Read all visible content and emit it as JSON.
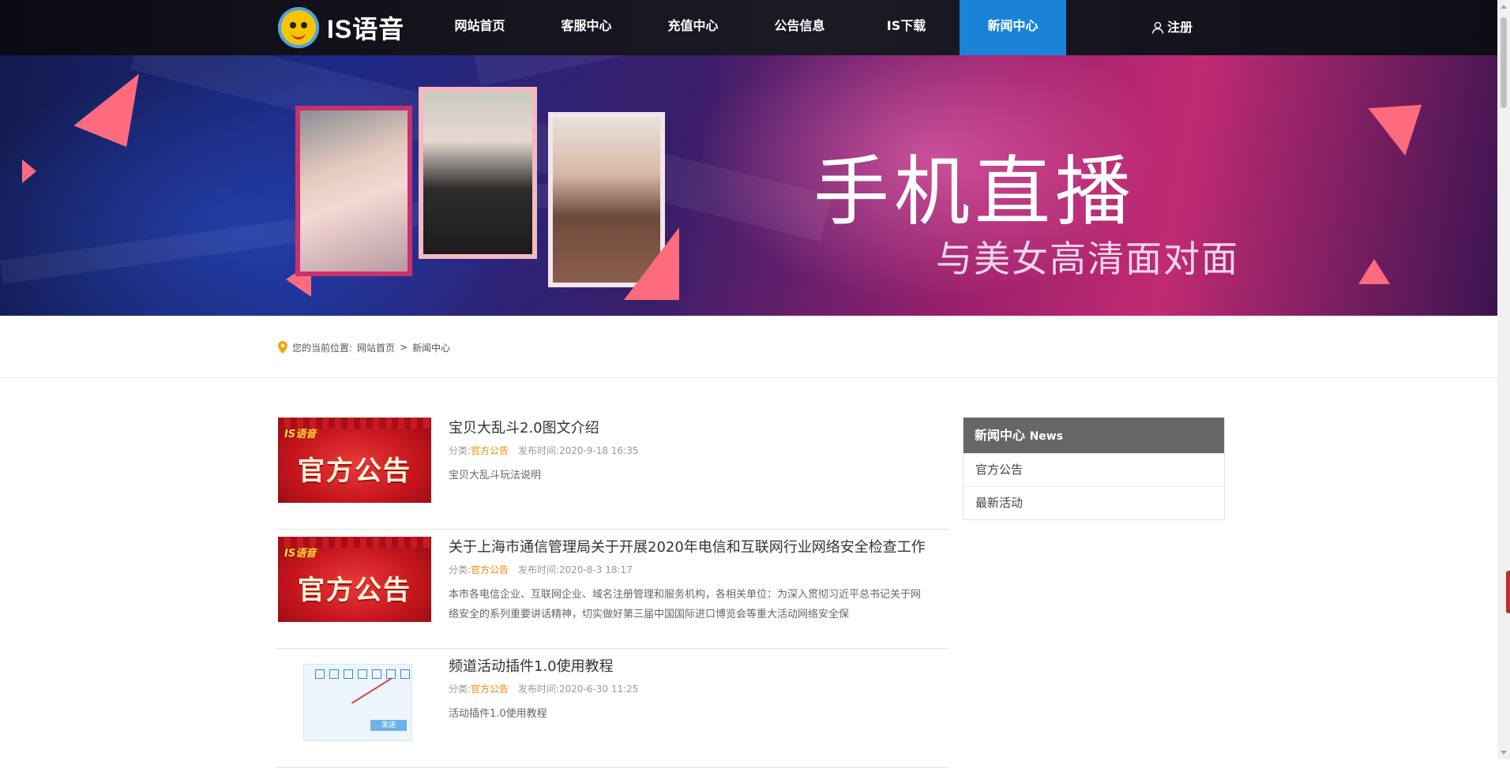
{
  "header": {
    "logo_text": "IS语音",
    "nav": [
      {
        "label": "网站首页",
        "active": false
      },
      {
        "label": "客服中心",
        "active": false
      },
      {
        "label": "充值中心",
        "active": false
      },
      {
        "label": "公告信息",
        "active": false
      },
      {
        "label": "IS下载",
        "active": false
      },
      {
        "label": "新闻中心",
        "active": true
      }
    ],
    "register_label": "注册",
    "colors": {
      "active_tab": "#1a83d8"
    }
  },
  "banner": {
    "title": "手机直播",
    "subtitle": "与美女高清面对面"
  },
  "breadcrumb": {
    "prefix": "您的当前位置:",
    "items": [
      "网站首页",
      "新闻中心"
    ],
    "separator": ">"
  },
  "news": [
    {
      "title": "宝贝大乱斗2.0图文介绍",
      "category_label": "分类:",
      "category": "官方公告",
      "time_label": "发布时间:",
      "time": "2020-9-18 16:35",
      "desc": "宝贝大乱斗玩法说明",
      "thumb_text": "官方公告",
      "thumb_brand": "IS语音"
    },
    {
      "title": "关于上海市通信管理局关于开展2020年电信和互联网行业网络安全检查工作",
      "category_label": "分类:",
      "category": "官方公告",
      "time_label": "发布时间:",
      "time": "2020-8-3 18:17",
      "desc": "本市各电信企业、互联网企业、域名注册管理和服务机构，各相关单位：为深入贯彻习近平总书记关于网络安全的系列重要讲话精神，切实做好第三届中国国际进口博览会等重大活动网络安全保",
      "thumb_text": "官方公告",
      "thumb_brand": "IS语音"
    },
    {
      "title": "频道活动插件1.0使用教程",
      "category_label": "分类:",
      "category": "官方公告",
      "time_label": "发布时间:",
      "time": "2020-6-30 11:25",
      "desc": "活动插件1.0使用教程",
      "thumb_send": "发送"
    }
  ],
  "sidebar": {
    "title": "新闻中心",
    "title_en": "News",
    "items": [
      "官方公告",
      "最新活动"
    ]
  }
}
